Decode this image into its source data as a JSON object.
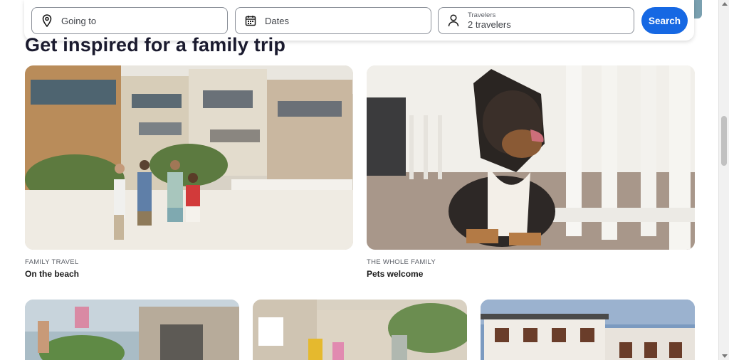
{
  "search": {
    "destination_placeholder": "Going to",
    "dates_placeholder": "Dates",
    "travelers_label": "Travelers",
    "travelers_value": "2 travelers",
    "search_label": "Search"
  },
  "section": {
    "heading": "Get inspired for a family trip"
  },
  "cards": [
    {
      "eyebrow": "FAMILY TRAVEL",
      "title": "On the beach"
    },
    {
      "eyebrow": "THE WHOLE FAMILY",
      "title": "Pets welcome"
    }
  ],
  "colors": {
    "accent": "#1668e3",
    "border": "#8a8f98",
    "heading": "#1a1a2e"
  },
  "icons": {
    "destination": "map-pin-icon",
    "dates": "calendar-icon",
    "travelers": "person-icon"
  }
}
